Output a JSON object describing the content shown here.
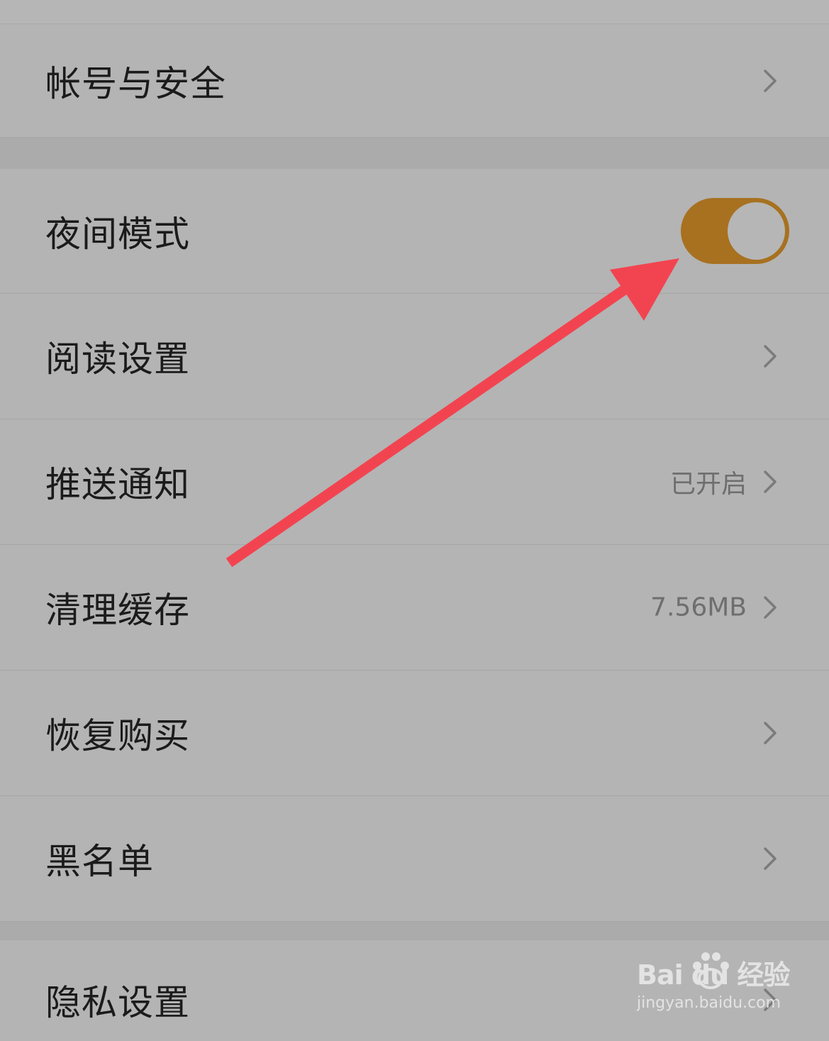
{
  "settings": {
    "account_security": {
      "label": "帐号与安全"
    },
    "night_mode": {
      "label": "夜间模式",
      "enabled": true,
      "toggle_color": "#a77120"
    },
    "reading_settings": {
      "label": "阅读设置"
    },
    "push_notification": {
      "label": "推送通知",
      "value": "已开启"
    },
    "clear_cache": {
      "label": "清理缓存",
      "value": "7.56MB"
    },
    "restore_purchase": {
      "label": "恢复购买"
    },
    "blacklist": {
      "label": "黑名单"
    },
    "privacy_settings": {
      "label": "隐私设置"
    }
  },
  "annotation": {
    "arrow_color": "#f24450"
  },
  "watermark": {
    "logo": "Bai du 经验",
    "url": "jingyan.baidu.com"
  }
}
